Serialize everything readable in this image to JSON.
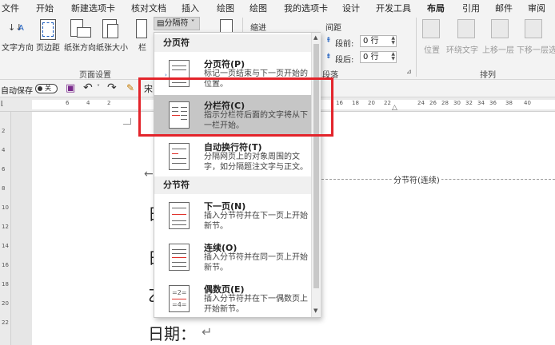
{
  "menu": {
    "tabs": [
      "文件",
      "开始",
      "新建选项卡",
      "核对文档",
      "插入",
      "绘图",
      "绘图",
      "我的选项卡",
      "设计",
      "开发工具",
      "布局",
      "引用",
      "邮件",
      "审阅"
    ],
    "active": "布局"
  },
  "ribbon": {
    "text_direction": "文字方向",
    "margins": "页边距",
    "orientation": "纸张方向",
    "size": "纸张大小",
    "columns": "栏",
    "breaks_button": "分隔符",
    "page_setup_group": "页面设置",
    "indent_label": "缩进",
    "spacing_label": "间距",
    "before_label": "段前:",
    "before_value": "0 行",
    "after_label": "段后:",
    "after_value": "0 行",
    "paragraph_group": "段落",
    "position": "位置",
    "wrap_text": "环绕文字",
    "bring_forward": "上移一层",
    "send_backward": "下移一层",
    "align_short": "选",
    "arrange_group": "排列"
  },
  "qat": {
    "autosave_label": "自动保存",
    "autosave_state": "关",
    "font_preview": "宋"
  },
  "ruler": {
    "left_numbers": [
      "6",
      "4",
      "2"
    ],
    "right_numbers": [
      "16",
      "18",
      "20",
      "22",
      "24",
      "26",
      "28",
      "30",
      "32",
      "34",
      "36",
      "38",
      "40"
    ]
  },
  "vruler": {
    "numbers": [
      "2",
      "4",
      "6",
      "8",
      "10",
      "12",
      "14",
      "16",
      "18",
      "20",
      "22"
    ]
  },
  "dropdown": {
    "page_breaks_header": "分页符",
    "section_breaks_header": "分节符",
    "items": [
      {
        "title": "分页符(P)",
        "desc": "标记一页结束与下一页开始的位置。"
      },
      {
        "title": "分栏符(C)",
        "desc": "指示分栏符后面的文字将从下一栏开始。"
      },
      {
        "title": "自动换行符(T)",
        "desc": "分隔网页上的对象周围的文字，如分隔题注文字与正文。"
      },
      {
        "title": "下一页(N)",
        "desc": "插入分节符并在下一页上开始新节。"
      },
      {
        "title": "连续(O)",
        "desc": "插入分节符并在同一页上开始新节。"
      },
      {
        "title": "偶数页(E)",
        "desc": "插入分节符并在下一偶数页上开始新节。"
      }
    ]
  },
  "document": {
    "section_break_marker": "分节符(连续)",
    "line_chars": [
      "日",
      "日",
      "乙"
    ],
    "date_label": "日期：",
    "return_mark": "↵"
  },
  "colors": {
    "accent": "#185abd",
    "highlight_box": "#e3242b",
    "highlight_item": "#c6c6c6"
  }
}
